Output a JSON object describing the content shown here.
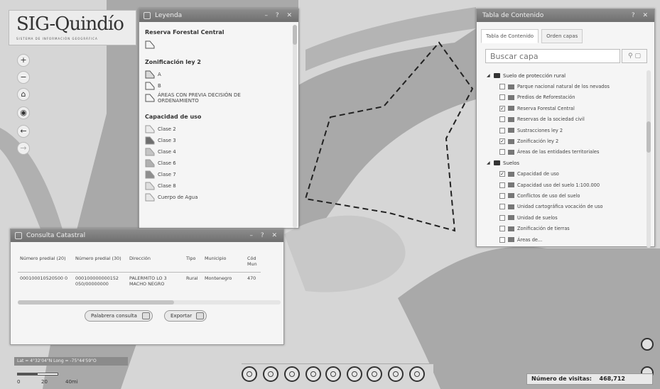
{
  "logo": {
    "title": "SIG-Quindío",
    "subtitle": "SISTEMA DE INFORMACIÓN GEOGRÁFICA"
  },
  "nav": [
    {
      "name": "zoom-in",
      "glyph": "+"
    },
    {
      "name": "zoom-out",
      "glyph": "−"
    },
    {
      "name": "home",
      "glyph": "⌂"
    },
    {
      "name": "locate",
      "glyph": "◉"
    },
    {
      "name": "back",
      "glyph": "←"
    },
    {
      "name": "forward",
      "glyph": "→"
    }
  ],
  "legend": {
    "title": "Leyenda",
    "controls": "– ? ✕",
    "sections": [
      {
        "title": "Reserva Forestal Central",
        "items": [
          {
            "label": "",
            "color": "#f4f4f4"
          }
        ]
      },
      {
        "title": "Zonificación ley 2",
        "items": [
          {
            "label": "A",
            "color": "#d9d9d9"
          },
          {
            "label": "B",
            "color": "#f4f4f4"
          },
          {
            "label": "ÁREAS CON PREVIA DECISIÓN DE ORDENAMIENTO",
            "color": "#f4f4f4"
          }
        ]
      },
      {
        "title": "Capacidad de uso",
        "items": [
          {
            "label": "Clase 2",
            "color": "#ececec"
          },
          {
            "label": "Clase 3",
            "color": "#6e6e6e"
          },
          {
            "label": "Clase 4",
            "color": "#c4c4c4"
          },
          {
            "label": "Clase 6",
            "color": "#b0b0b0"
          },
          {
            "label": "Clase 7",
            "color": "#8e8e8e"
          },
          {
            "label": "Clase 8",
            "color": "#dedede"
          },
          {
            "label": "Cuerpo de Agua",
            "color": "#e8e8e8"
          }
        ]
      }
    ]
  },
  "toc": {
    "title": "Tabla de Contenido",
    "controls": "? ✕",
    "tabs": [
      "Tabla de Contenido",
      "Orden capas"
    ],
    "search_placeholder": "Buscar capa",
    "tree": [
      {
        "type": "group",
        "label": "Suelo de protección rural"
      },
      {
        "type": "layer",
        "label": "Parque nacional natural de los nevados",
        "checked": false
      },
      {
        "type": "layer",
        "label": "Predios de Reforestación",
        "checked": false
      },
      {
        "type": "layer",
        "label": "Reserva Forestal Central",
        "checked": true
      },
      {
        "type": "layer",
        "label": "Reservas de la sociedad civil",
        "checked": false
      },
      {
        "type": "layer",
        "label": "Sustracciones ley 2",
        "checked": false
      },
      {
        "type": "layer",
        "label": "Zonificación ley 2",
        "checked": true
      },
      {
        "type": "layer",
        "label": "Áreas de las entidades territoriales",
        "checked": false
      },
      {
        "type": "group",
        "label": "Suelos"
      },
      {
        "type": "layer",
        "label": "Capacidad de uso",
        "checked": true
      },
      {
        "type": "layer",
        "label": "Capacidad uso del suelo 1:100.000",
        "checked": false
      },
      {
        "type": "layer",
        "label": "Conflictos de uso del suelo",
        "checked": false
      },
      {
        "type": "layer",
        "label": "Unidad cartográfica vocación de uso",
        "checked": false
      },
      {
        "type": "layer",
        "label": "Unidad de suelos",
        "checked": false
      },
      {
        "type": "layer",
        "label": "Zonificación de tierras",
        "checked": false
      },
      {
        "type": "layer",
        "label": "Áreas de...",
        "checked": false
      }
    ]
  },
  "consulta": {
    "title": "Consulta Catastral",
    "controls": "– ? ✕",
    "columns": [
      "Número predial (20)",
      "Número predial (30)",
      "Dirección",
      "Tipo",
      "Municipio",
      "Cód Mun"
    ],
    "rows": [
      [
        "000100010520500 0",
        "000100000000152 050/00000000",
        "PALERMITO LO 3 MACHO NEGRO",
        "Rural",
        "Montenegro",
        "470"
      ]
    ],
    "buttons": [
      "Palabrera consulta",
      "Exportar"
    ]
  },
  "coords": "Lat = 4°32'04\"N Long = -75°44'59\"O",
  "scale": {
    "labels": [
      "0",
      "20",
      "40mi"
    ]
  },
  "visits": {
    "label": "Número de visitas:",
    "value": "468,712"
  },
  "colors": {
    "map_light": "#d9d9d9",
    "map_dark": "#a7a7a7",
    "panel_title": "#7a7a7a"
  }
}
